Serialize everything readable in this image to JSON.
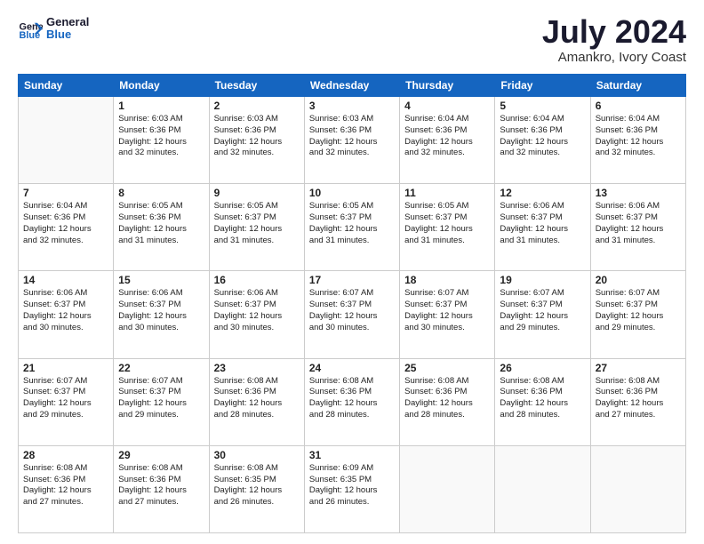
{
  "header": {
    "logo_line1": "General",
    "logo_line2": "Blue",
    "month": "July 2024",
    "location": "Amankro, Ivory Coast"
  },
  "weekdays": [
    "Sunday",
    "Monday",
    "Tuesday",
    "Wednesday",
    "Thursday",
    "Friday",
    "Saturday"
  ],
  "weeks": [
    [
      {
        "day": "",
        "info": ""
      },
      {
        "day": "1",
        "info": "Sunrise: 6:03 AM\nSunset: 6:36 PM\nDaylight: 12 hours\nand 32 minutes."
      },
      {
        "day": "2",
        "info": "Sunrise: 6:03 AM\nSunset: 6:36 PM\nDaylight: 12 hours\nand 32 minutes."
      },
      {
        "day": "3",
        "info": "Sunrise: 6:03 AM\nSunset: 6:36 PM\nDaylight: 12 hours\nand 32 minutes."
      },
      {
        "day": "4",
        "info": "Sunrise: 6:04 AM\nSunset: 6:36 PM\nDaylight: 12 hours\nand 32 minutes."
      },
      {
        "day": "5",
        "info": "Sunrise: 6:04 AM\nSunset: 6:36 PM\nDaylight: 12 hours\nand 32 minutes."
      },
      {
        "day": "6",
        "info": "Sunrise: 6:04 AM\nSunset: 6:36 PM\nDaylight: 12 hours\nand 32 minutes."
      }
    ],
    [
      {
        "day": "7",
        "info": "Sunrise: 6:04 AM\nSunset: 6:36 PM\nDaylight: 12 hours\nand 32 minutes."
      },
      {
        "day": "8",
        "info": "Sunrise: 6:05 AM\nSunset: 6:36 PM\nDaylight: 12 hours\nand 31 minutes."
      },
      {
        "day": "9",
        "info": "Sunrise: 6:05 AM\nSunset: 6:37 PM\nDaylight: 12 hours\nand 31 minutes."
      },
      {
        "day": "10",
        "info": "Sunrise: 6:05 AM\nSunset: 6:37 PM\nDaylight: 12 hours\nand 31 minutes."
      },
      {
        "day": "11",
        "info": "Sunrise: 6:05 AM\nSunset: 6:37 PM\nDaylight: 12 hours\nand 31 minutes."
      },
      {
        "day": "12",
        "info": "Sunrise: 6:06 AM\nSunset: 6:37 PM\nDaylight: 12 hours\nand 31 minutes."
      },
      {
        "day": "13",
        "info": "Sunrise: 6:06 AM\nSunset: 6:37 PM\nDaylight: 12 hours\nand 31 minutes."
      }
    ],
    [
      {
        "day": "14",
        "info": "Sunrise: 6:06 AM\nSunset: 6:37 PM\nDaylight: 12 hours\nand 30 minutes."
      },
      {
        "day": "15",
        "info": "Sunrise: 6:06 AM\nSunset: 6:37 PM\nDaylight: 12 hours\nand 30 minutes."
      },
      {
        "day": "16",
        "info": "Sunrise: 6:06 AM\nSunset: 6:37 PM\nDaylight: 12 hours\nand 30 minutes."
      },
      {
        "day": "17",
        "info": "Sunrise: 6:07 AM\nSunset: 6:37 PM\nDaylight: 12 hours\nand 30 minutes."
      },
      {
        "day": "18",
        "info": "Sunrise: 6:07 AM\nSunset: 6:37 PM\nDaylight: 12 hours\nand 30 minutes."
      },
      {
        "day": "19",
        "info": "Sunrise: 6:07 AM\nSunset: 6:37 PM\nDaylight: 12 hours\nand 29 minutes."
      },
      {
        "day": "20",
        "info": "Sunrise: 6:07 AM\nSunset: 6:37 PM\nDaylight: 12 hours\nand 29 minutes."
      }
    ],
    [
      {
        "day": "21",
        "info": "Sunrise: 6:07 AM\nSunset: 6:37 PM\nDaylight: 12 hours\nand 29 minutes."
      },
      {
        "day": "22",
        "info": "Sunrise: 6:07 AM\nSunset: 6:37 PM\nDaylight: 12 hours\nand 29 minutes."
      },
      {
        "day": "23",
        "info": "Sunrise: 6:08 AM\nSunset: 6:36 PM\nDaylight: 12 hours\nand 28 minutes."
      },
      {
        "day": "24",
        "info": "Sunrise: 6:08 AM\nSunset: 6:36 PM\nDaylight: 12 hours\nand 28 minutes."
      },
      {
        "day": "25",
        "info": "Sunrise: 6:08 AM\nSunset: 6:36 PM\nDaylight: 12 hours\nand 28 minutes."
      },
      {
        "day": "26",
        "info": "Sunrise: 6:08 AM\nSunset: 6:36 PM\nDaylight: 12 hours\nand 28 minutes."
      },
      {
        "day": "27",
        "info": "Sunrise: 6:08 AM\nSunset: 6:36 PM\nDaylight: 12 hours\nand 27 minutes."
      }
    ],
    [
      {
        "day": "28",
        "info": "Sunrise: 6:08 AM\nSunset: 6:36 PM\nDaylight: 12 hours\nand 27 minutes."
      },
      {
        "day": "29",
        "info": "Sunrise: 6:08 AM\nSunset: 6:36 PM\nDaylight: 12 hours\nand 27 minutes."
      },
      {
        "day": "30",
        "info": "Sunrise: 6:08 AM\nSunset: 6:35 PM\nDaylight: 12 hours\nand 26 minutes."
      },
      {
        "day": "31",
        "info": "Sunrise: 6:09 AM\nSunset: 6:35 PM\nDaylight: 12 hours\nand 26 minutes."
      },
      {
        "day": "",
        "info": ""
      },
      {
        "day": "",
        "info": ""
      },
      {
        "day": "",
        "info": ""
      }
    ]
  ]
}
